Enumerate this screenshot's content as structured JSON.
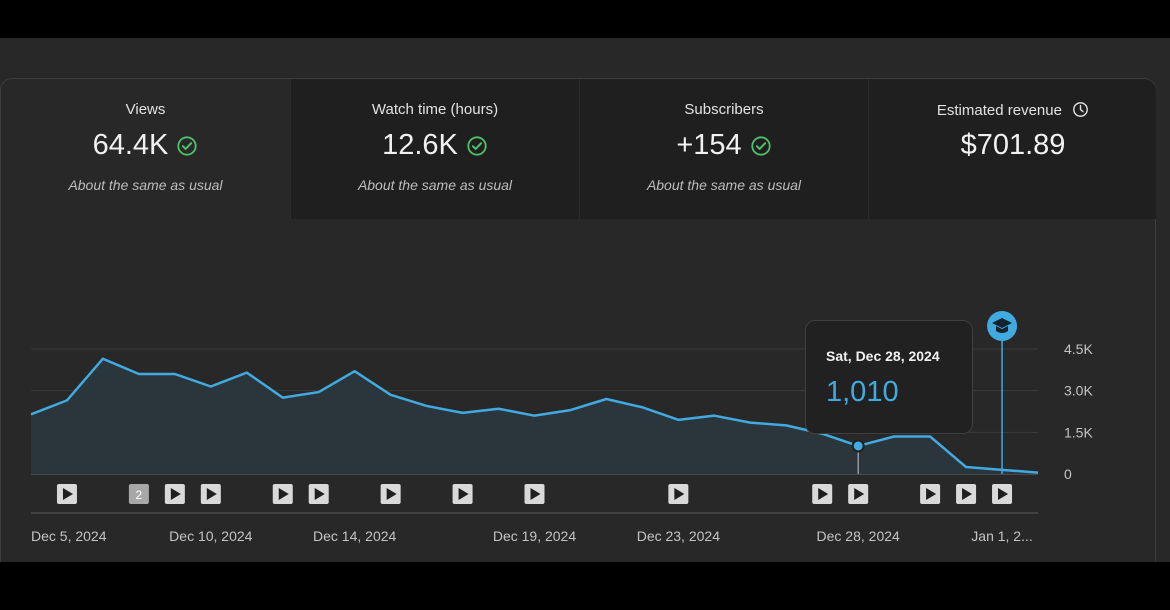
{
  "cards": [
    {
      "label": "Views",
      "value": "64.4K",
      "note": "About the same as usual",
      "status_icon": "check-circle-icon"
    },
    {
      "label": "Watch time (hours)",
      "value": "12.6K",
      "note": "About the same as usual",
      "status_icon": "check-circle-icon"
    },
    {
      "label": "Subscribers",
      "value": "+154",
      "note": "About the same as usual",
      "status_icon": "check-circle-icon"
    },
    {
      "label": "Estimated revenue",
      "value": "$701.89",
      "info_icon": "clock-icon"
    }
  ],
  "colors": {
    "line": "#41aae0",
    "area": "#2b353c",
    "check": "#4fbf6a",
    "marker_fill": "#d9d9d9"
  },
  "tooltip": {
    "date": "Sat, Dec 28, 2024",
    "value": "1,010"
  },
  "chart_data": {
    "type": "area",
    "x": [
      "2024-12-05",
      "2024-12-06",
      "2024-12-07",
      "2024-12-08",
      "2024-12-09",
      "2024-12-10",
      "2024-12-11",
      "2024-12-12",
      "2024-12-13",
      "2024-12-14",
      "2024-12-15",
      "2024-12-16",
      "2024-12-17",
      "2024-12-18",
      "2024-12-19",
      "2024-12-20",
      "2024-12-21",
      "2024-12-22",
      "2024-12-23",
      "2024-12-24",
      "2024-12-25",
      "2024-12-26",
      "2024-12-27",
      "2024-12-28",
      "2024-12-29",
      "2024-12-30",
      "2024-12-31",
      "2025-01-01",
      "2025-01-02"
    ],
    "y": [
      2150,
      2650,
      4150,
      3600,
      3600,
      3150,
      3650,
      2750,
      2950,
      3700,
      2850,
      2450,
      2200,
      2350,
      2100,
      2300,
      2700,
      2400,
      1950,
      2100,
      1850,
      1750,
      1450,
      1010,
      1350,
      1350,
      250,
      150,
      50
    ],
    "x_ticks": [
      "Dec 5, 2024",
      "Dec 10, 2024",
      "Dec 14, 2024",
      "Dec 19, 2024",
      "Dec 23, 2024",
      "Dec 28, 2024",
      "Jan 1, 2..."
    ],
    "x_tick_dates": [
      "2024-12-05",
      "2024-12-10",
      "2024-12-14",
      "2024-12-19",
      "2024-12-23",
      "2024-12-28",
      "2025-01-01"
    ],
    "y_ticks": [
      "4.5K",
      "3.0K",
      "1.5K",
      "0"
    ],
    "y_tick_values": [
      4500,
      3000,
      1500,
      0
    ],
    "ylim": [
      0,
      4500
    ],
    "grid": true,
    "y_axis_side": "right",
    "highlight_date": "2024-12-28",
    "milestone_date": "2025-01-01",
    "milestone_icon": "graduation-cap-icon",
    "markers": [
      {
        "date": "2024-12-06"
      },
      {
        "date": "2024-12-08",
        "label": "2"
      },
      {
        "date": "2024-12-09"
      },
      {
        "date": "2024-12-10"
      },
      {
        "date": "2024-12-12"
      },
      {
        "date": "2024-12-13"
      },
      {
        "date": "2024-12-15"
      },
      {
        "date": "2024-12-17"
      },
      {
        "date": "2024-12-19"
      },
      {
        "date": "2024-12-23"
      },
      {
        "date": "2024-12-27"
      },
      {
        "date": "2024-12-28"
      },
      {
        "date": "2024-12-30"
      },
      {
        "date": "2024-12-31"
      },
      {
        "date": "2025-01-01"
      }
    ],
    "marker_icon": "play-icon"
  }
}
